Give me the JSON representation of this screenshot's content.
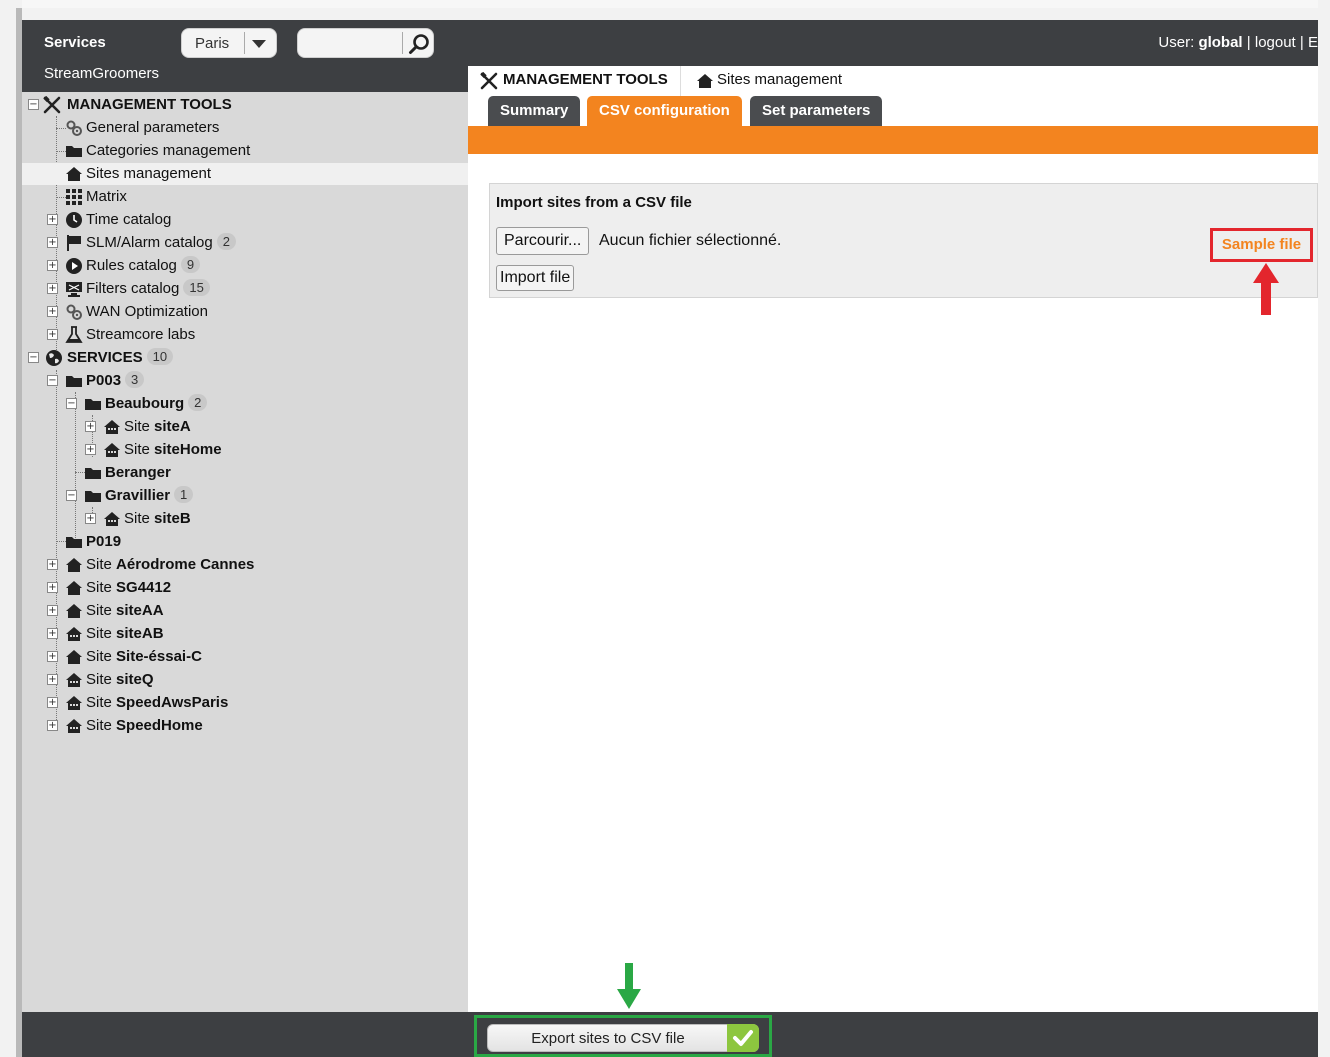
{
  "header": {
    "services_label": "Services",
    "org_name": "StreamGroomers",
    "city_selected": "Paris",
    "search_placeholder": "",
    "user_prefix": "User:",
    "user_name": "global",
    "separator": "|",
    "logout_label": "logout",
    "truncated_link": "E"
  },
  "sidebar": {
    "management_tools": "MANAGEMENT TOOLS",
    "general_parameters": "General parameters",
    "categories_management": "Categories management",
    "sites_management": "Sites management",
    "matrix": "Matrix",
    "time_catalog": "Time catalog",
    "slm_alarm_catalog": "SLM/Alarm catalog",
    "slm_alarm_count": "2",
    "rules_catalog": "Rules catalog",
    "rules_count": "9",
    "filters_catalog": "Filters catalog",
    "filters_count": "15",
    "wan_optimization": "WAN Optimization",
    "streamcore_labs": "Streamcore labs",
    "services": "SERVICES",
    "services_count": "10",
    "p003": "P003",
    "p003_count": "3",
    "beaubourg": "Beaubourg",
    "beaubourg_count": "2",
    "site_prefix": "Site",
    "siteA": "siteA",
    "siteHome": "siteHome",
    "beranger": "Beranger",
    "gravillier": "Gravillier",
    "gravillier_count": "1",
    "siteB": "siteB",
    "p019": "P019",
    "aerodrome_cannes": "Aérodrome Cannes",
    "sg4412": "SG4412",
    "siteAA": "siteAA",
    "siteAB": "siteAB",
    "site_essai_c": "Site-éssai-C",
    "siteQ": "siteQ",
    "speedAwsParis": "SpeedAwsParis",
    "speedHome": "SpeedHome"
  },
  "main": {
    "crumb_tools": "MANAGEMENT TOOLS",
    "crumb_sites": "Sites management",
    "tabs": [
      "Summary",
      "CSV configuration",
      "Set parameters"
    ],
    "active_tab": "CSV configuration",
    "import_title": "Import sites from a CSV file",
    "browse_label": "Parcourir...",
    "no_file_label": "Aucun fichier sélectionné.",
    "import_label": "Import file",
    "sample_file_label": "Sample file"
  },
  "footer": {
    "export_label": "Export sites to CSV file"
  },
  "colors": {
    "accent_orange": "#f3841f",
    "dark_bar": "#3d3f42",
    "highlight_red": "#e3262d",
    "highlight_green": "#2aa845",
    "check_green": "#8dc63f"
  }
}
